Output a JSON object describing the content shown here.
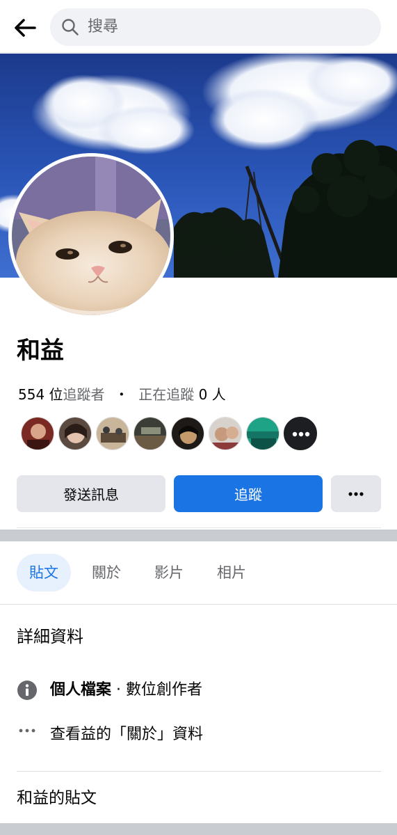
{
  "header": {
    "back_icon": "arrow-left-icon",
    "search_placeholder": "搜尋"
  },
  "profile": {
    "name": "和益",
    "followers_count": "554",
    "followers_label_unit": "位",
    "followers_label": "追蹤者",
    "separator": "・",
    "following_label": "正在追蹤",
    "following_count": "0",
    "following_unit": "人"
  },
  "follower_avatars_more": "•••",
  "actions": {
    "message_label": "發送訊息",
    "follow_label": "追蹤",
    "more_label": "•••"
  },
  "tabs": [
    {
      "label": "貼文",
      "active": true
    },
    {
      "label": "關於",
      "active": false
    },
    {
      "label": "影片",
      "active": false
    },
    {
      "label": "相片",
      "active": false
    }
  ],
  "details": {
    "title": "詳細資料",
    "profile_type_label": "個人檔案",
    "profile_type_sep": " · ",
    "profile_type_value": "數位創作者",
    "about_link": "查看益的「關於」資料"
  },
  "posts_title": "和益的貼文",
  "colors": {
    "accent": "#1b74e4",
    "button_gray": "#e4e6eb",
    "muted_text": "#65676b",
    "divider": "#c9ccd1"
  }
}
